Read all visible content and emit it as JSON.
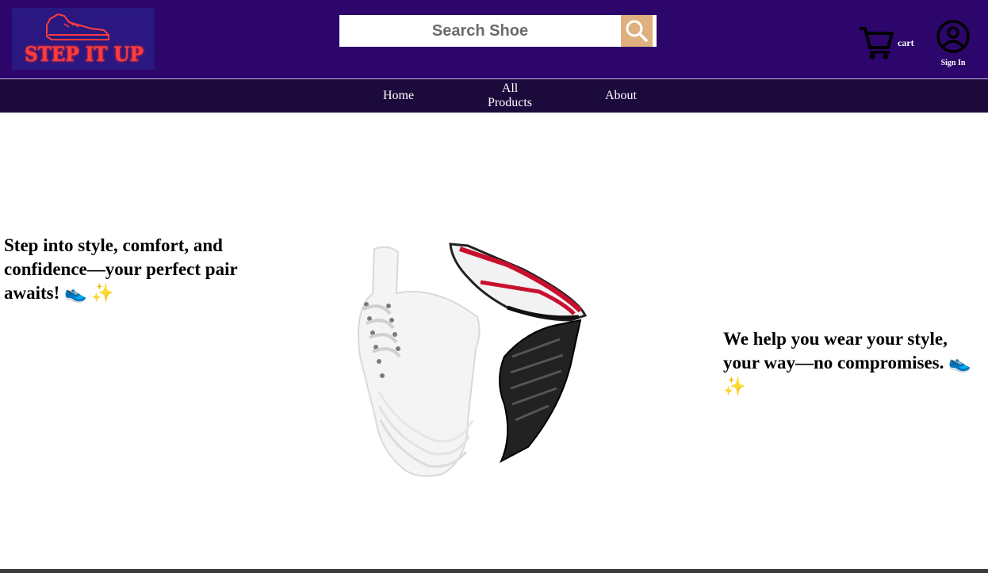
{
  "brand": {
    "logo_text": "STEP IT UP"
  },
  "search": {
    "placeholder": "Search Shoe"
  },
  "header": {
    "cart_label": "cart",
    "signin_label": "Sign In"
  },
  "nav": {
    "home": "Home",
    "all_products_line1": "All",
    "all_products_line2": "Products",
    "about": "About"
  },
  "hero": {
    "left_text": "Step into style, comfort, and confidence—your perfect pair awaits! 👟 ✨",
    "right_text": "We help you wear your style, your way—no compromises. 👟 ✨"
  },
  "colors": {
    "header_bg": "#2c066a",
    "nav_bg": "#1c0a3c",
    "search_button": "#e0b080",
    "logo_text": "#ff3b3b"
  },
  "icons": [
    "search-icon",
    "cart-icon",
    "user-icon",
    "sneaker-logo-icon"
  ]
}
